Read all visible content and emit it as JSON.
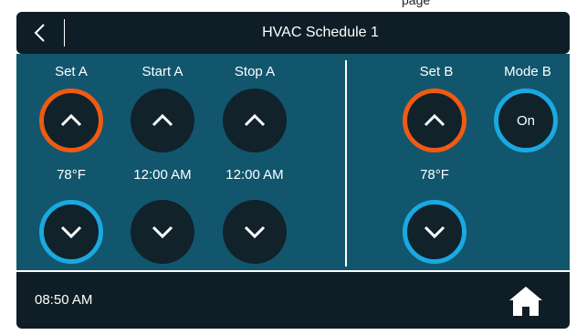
{
  "page_label": "page",
  "header": {
    "title": "HVAC Schedule 1"
  },
  "zone_a": {
    "set_label": "Set A",
    "start_label": "Start A",
    "stop_label": "Stop A",
    "set_value": "78°F",
    "start_value": "12:00 AM",
    "stop_value": "12:00 AM"
  },
  "zone_b": {
    "set_label": "Set B",
    "mode_label": "Mode B",
    "set_value": "78°F",
    "mode_value": "On"
  },
  "footer": {
    "time": "08:50 AM"
  },
  "colors": {
    "panel": "#11566d",
    "bar": "#0f1e26",
    "button": "#11222b",
    "accent_orange": "#f05a12",
    "accent_blue": "#1aa9e1"
  },
  "icons": [
    "back-chevron-icon",
    "chevron-up-icon",
    "chevron-down-icon",
    "home-icon"
  ]
}
